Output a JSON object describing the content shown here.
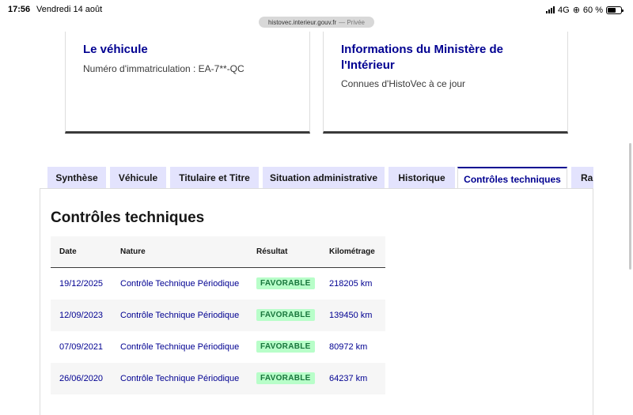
{
  "status_bar": {
    "time": "17:56",
    "date": "Vendredi 14 août",
    "network": "4G",
    "battery_percent": "60 %",
    "battery_level": 0.6
  },
  "browser": {
    "url": "histovec.interieur.gouv.fr",
    "private_label": "— Privée"
  },
  "cards": {
    "vehicle": {
      "title": "Le véhicule",
      "description": "Numéro d'immatriculation : EA-7**-QC"
    },
    "ministry": {
      "title": "Informations du Ministère de l'Intérieur",
      "description": "Connues d'HistoVec à ce jour"
    }
  },
  "tabs": [
    {
      "label": "Synthèse",
      "active": false
    },
    {
      "label": "Véhicule",
      "active": false
    },
    {
      "label": "Titulaire et Titre",
      "active": false
    },
    {
      "label": "Situation administrative",
      "active": false
    },
    {
      "label": "Historique",
      "active": false
    },
    {
      "label": "Contrôles techniques",
      "active": true
    },
    {
      "label": "Rap",
      "active": false
    }
  ],
  "panel": {
    "title": "Contrôles techniques",
    "table": {
      "headers": [
        "Date",
        "Nature",
        "Résultat",
        "Kilométrage"
      ],
      "rows": [
        {
          "date": "19/12/2025",
          "nature": "Contrôle Technique Périodique",
          "result": "FAVORABLE",
          "km": "218205 km"
        },
        {
          "date": "12/09/2023",
          "nature": "Contrôle Technique Périodique",
          "result": "FAVORABLE",
          "km": "139450 km"
        },
        {
          "date": "07/09/2021",
          "nature": "Contrôle Technique Périodique",
          "result": "FAVORABLE",
          "km": "80972 km"
        },
        {
          "date": "26/06/2020",
          "nature": "Contrôle Technique Périodique",
          "result": "FAVORABLE",
          "km": "64237 km"
        }
      ]
    }
  },
  "colors": {
    "primary_blue": "#000091",
    "tab_bg": "#e3e3fd",
    "badge_bg": "#b8fec9",
    "badge_text": "#18753c"
  }
}
